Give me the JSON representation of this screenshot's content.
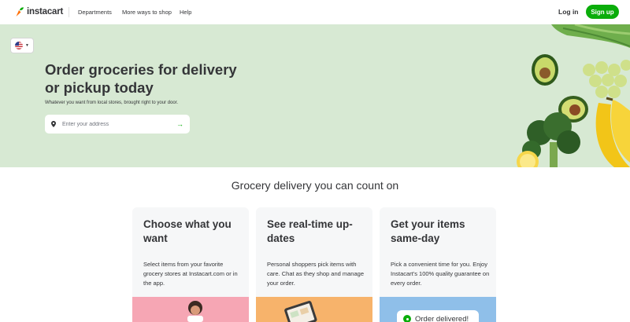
{
  "header": {
    "brand": "instacart",
    "nav": [
      "Departments",
      "More ways to shop",
      "Help"
    ],
    "login_label": "Log in",
    "signup_label": "Sign up"
  },
  "hero": {
    "locale_flag": "us-flag",
    "title": "Order groceries for delivery or pickup today",
    "subtitle": "Whatever you want from local stores, brought right to your door.",
    "address_placeholder": "Enter your address",
    "submit_arrow": "→"
  },
  "section": {
    "title": "Grocery delivery you can count on",
    "cards": [
      {
        "title": "Choose what you want",
        "body": "Select items from your favorite grocery stores at Instacart.com or in the app."
      },
      {
        "title": "See real-time up-dates",
        "body": "Personal shoppers pick items with care. Chat as they shop and manage your order."
      },
      {
        "title": "Get your items same-day",
        "body": "Pick a convenient time for you. Enjoy Instacart's 100% quality guarantee on every order."
      }
    ],
    "delivered_badge": "Order delivered!"
  },
  "colors": {
    "brand_green": "#0aad0a",
    "hero_bg": "#d7e9d3",
    "card_bg": "#f6f7f8"
  }
}
